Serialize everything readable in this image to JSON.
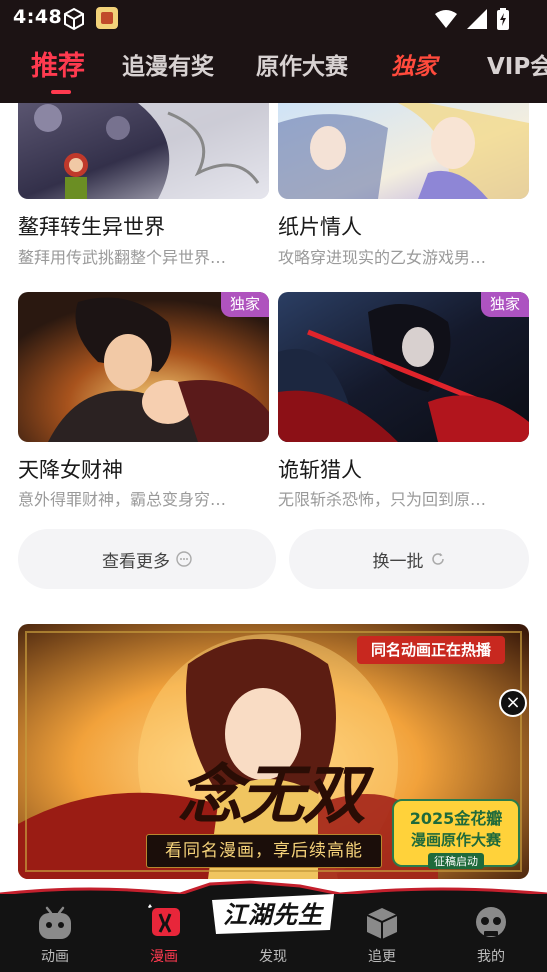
{
  "status_bar": {
    "time": "4:48"
  },
  "tabs": [
    {
      "label": "推荐",
      "state": "active"
    },
    {
      "label": "追漫有奖",
      "state": "normal"
    },
    {
      "label": "原作大赛",
      "state": "normal"
    },
    {
      "label": "独家",
      "state": "exclusive"
    },
    {
      "label": "VIP会",
      "state": "normal"
    }
  ],
  "comics": [
    {
      "title": "鳌拜转生异世界",
      "desc": "鳌拜用传武挑翻整个异世界…",
      "badge": ""
    },
    {
      "title": "纸片情人",
      "desc": "攻略穿进现实的乙女游戏男…",
      "badge": ""
    },
    {
      "title": "天降女财神",
      "desc": "意外得罪财神，霸总变身穷…",
      "badge": "独家"
    },
    {
      "title": "诡斩猎人",
      "desc": "无限斩杀恐怖，只为回到原…",
      "badge": "独家"
    }
  ],
  "actions": {
    "more_label": "查看更多",
    "refresh_label": "换一批"
  },
  "banner": {
    "tag": "同名动画正在热播",
    "title_art": "念无双",
    "caption": "看同名漫画，享后续高能",
    "contest_year": "2025",
    "contest_line1": "金花瓣",
    "contest_line2": "漫画原作大赛",
    "contest_line3": "征稿启动"
  },
  "bottom_nav": {
    "items": [
      {
        "label": "动画",
        "icon": "tv-mascot-icon"
      },
      {
        "label": "漫画",
        "icon": "comic-book-icon",
        "active": true
      },
      {
        "label": "发现",
        "icon": "discover-logo-icon"
      },
      {
        "label": "追更",
        "icon": "cube-box-icon"
      },
      {
        "label": "我的",
        "icon": "skull-face-icon"
      }
    ],
    "logo_text": "江湖先生"
  },
  "colors": {
    "accent": "#ff3a4f",
    "header_bg": "#1c1314",
    "nav_bg": "#131313"
  }
}
